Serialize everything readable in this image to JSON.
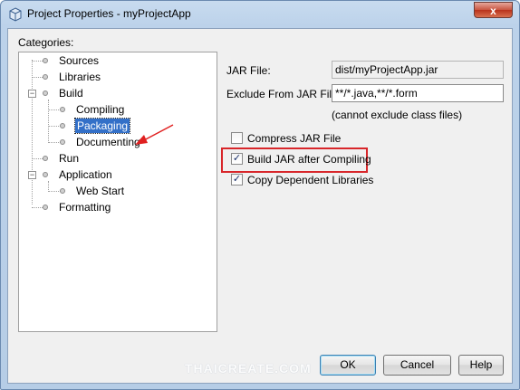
{
  "window": {
    "title": "Project Properties - myProjectApp",
    "close_label": "x"
  },
  "categories_label": "Categories:",
  "tree": {
    "sources": "Sources",
    "libraries": "Libraries",
    "build": "Build",
    "compiling": "Compiling",
    "packaging": "Packaging",
    "documenting": "Documenting",
    "run": "Run",
    "application": "Application",
    "web_start": "Web Start",
    "formatting": "Formatting",
    "collapse_glyph": "−",
    "selected": "Packaging"
  },
  "form": {
    "jar_file_label": "JAR File:",
    "jar_file_value": "dist/myProjectApp.jar",
    "exclude_label": "Exclude From JAR File:",
    "exclude_value": "**/*.java,**/*.form",
    "exclude_hint": "(cannot exclude class files)"
  },
  "options": {
    "compress_jar": {
      "label": "Compress JAR File",
      "checked": false
    },
    "build_jar": {
      "label": "Build JAR after Compiling",
      "checked": true
    },
    "copy_libs": {
      "label": "Copy Dependent Libraries",
      "checked": true
    },
    "check_glyph": "✓"
  },
  "buttons": {
    "ok": "OK",
    "cancel": "Cancel",
    "help": "Help"
  },
  "watermark": "THAICREATE.COM",
  "colors": {
    "highlight": "#d8262a",
    "selection": "#3370c8",
    "arrow": "#e02020"
  }
}
